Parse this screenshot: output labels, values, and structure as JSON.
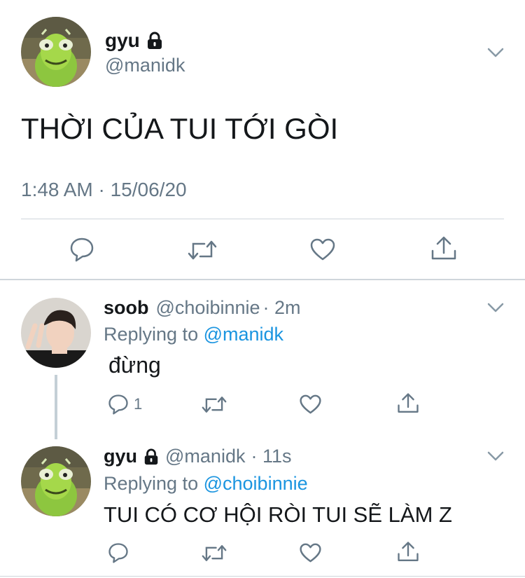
{
  "main_tweet": {
    "display_name": "gyu",
    "locked_icon": "lock-icon",
    "handle": "@manidk",
    "text": "THỜI CỦA TUI TỚI GÒI",
    "timestamp": "1:48 AM · 15/06/20"
  },
  "reply_1": {
    "display_name": "soob",
    "handle": "@choibinnie",
    "dot_time": "· 2m",
    "replying_prefix": "Replying to",
    "replying_to": "@manidk",
    "text": "đừng",
    "reply_count": "1"
  },
  "reply_2": {
    "display_name": "gyu",
    "locked_icon": "lock-icon",
    "handle": "@manidk",
    "dot_time": "· 11s",
    "replying_prefix": "Replying to",
    "replying_to": "@choibinnie",
    "text": "TUI CÓ CƠ HỘI RÒI TUI SẼ LÀM Z"
  },
  "icons": [
    "chevron-down-icon",
    "reply-icon",
    "retweet-icon",
    "like-icon",
    "share-icon",
    "lock-icon"
  ],
  "colors": {
    "link": "#1b95e0",
    "gray": "#657786",
    "icon": "#657786",
    "text": "#14171a"
  }
}
